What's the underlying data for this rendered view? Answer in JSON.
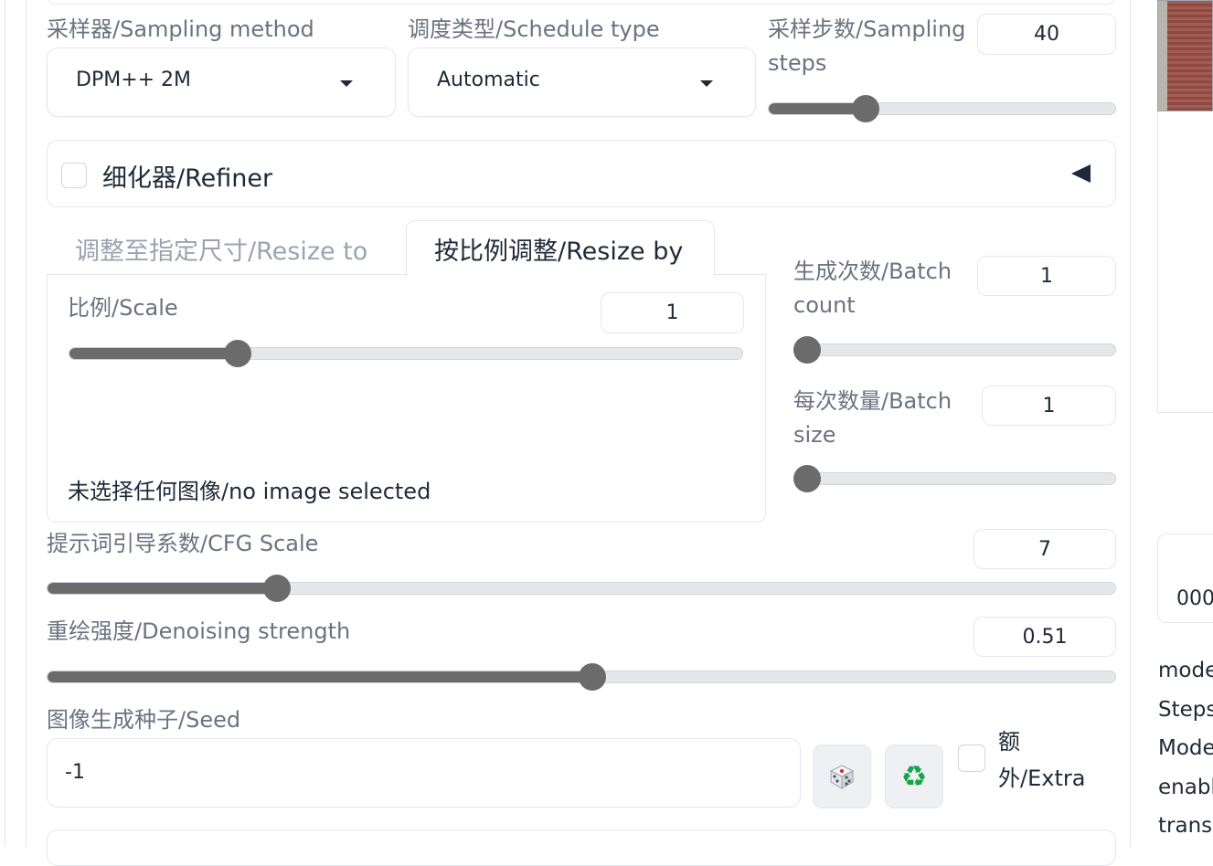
{
  "sampling": {
    "method_label": "采样器/Sampling method",
    "method_value": "DPM++ 2M",
    "schedule_label": "调度类型/Schedule type",
    "schedule_value": "Automatic",
    "steps_label": "采样步数/Sampling steps",
    "steps_value": "40",
    "steps_fraction": 0.28
  },
  "refiner": {
    "label": "细化器/Refiner",
    "toggle_icon": "collapse-left-triangle"
  },
  "resize": {
    "tabs": [
      {
        "label": "调整至指定尺寸/Resize to",
        "active": false
      },
      {
        "label": "按比例调整/Resize by",
        "active": true
      }
    ],
    "scale_label": "比例/Scale",
    "scale_value": "1",
    "scale_fraction": 0.25,
    "no_image_text": "未选择任何图像/no image selected"
  },
  "batch": {
    "count_label": "生成次数/Batch count",
    "count_value": "1",
    "count_fraction": 0.0,
    "size_label": "每次数量/Batch size",
    "size_value": "1",
    "size_fraction": 0.0
  },
  "cfg": {
    "label": "提示词引导系数/CFG Scale",
    "value": "7",
    "fraction": 0.215
  },
  "denoise": {
    "label": "重绘强度/Denoising strength",
    "value": "0.51",
    "fraction": 0.51
  },
  "seed": {
    "label": "图像生成种子/Seed",
    "value": "-1",
    "dice_icon": "dice-icon",
    "reuse_icon": "recycle-icon",
    "extra_label": "额外/Extra"
  },
  "right_panel": {
    "partial_number": "000",
    "text_lines": [
      "mode",
      "Steps",
      "Mode",
      "enabl",
      "transi"
    ]
  },
  "colors": {
    "slider": "#6b6b6b",
    "track": "#e5e7eb",
    "label": "#6b7280",
    "recycle": "#16a34a"
  }
}
